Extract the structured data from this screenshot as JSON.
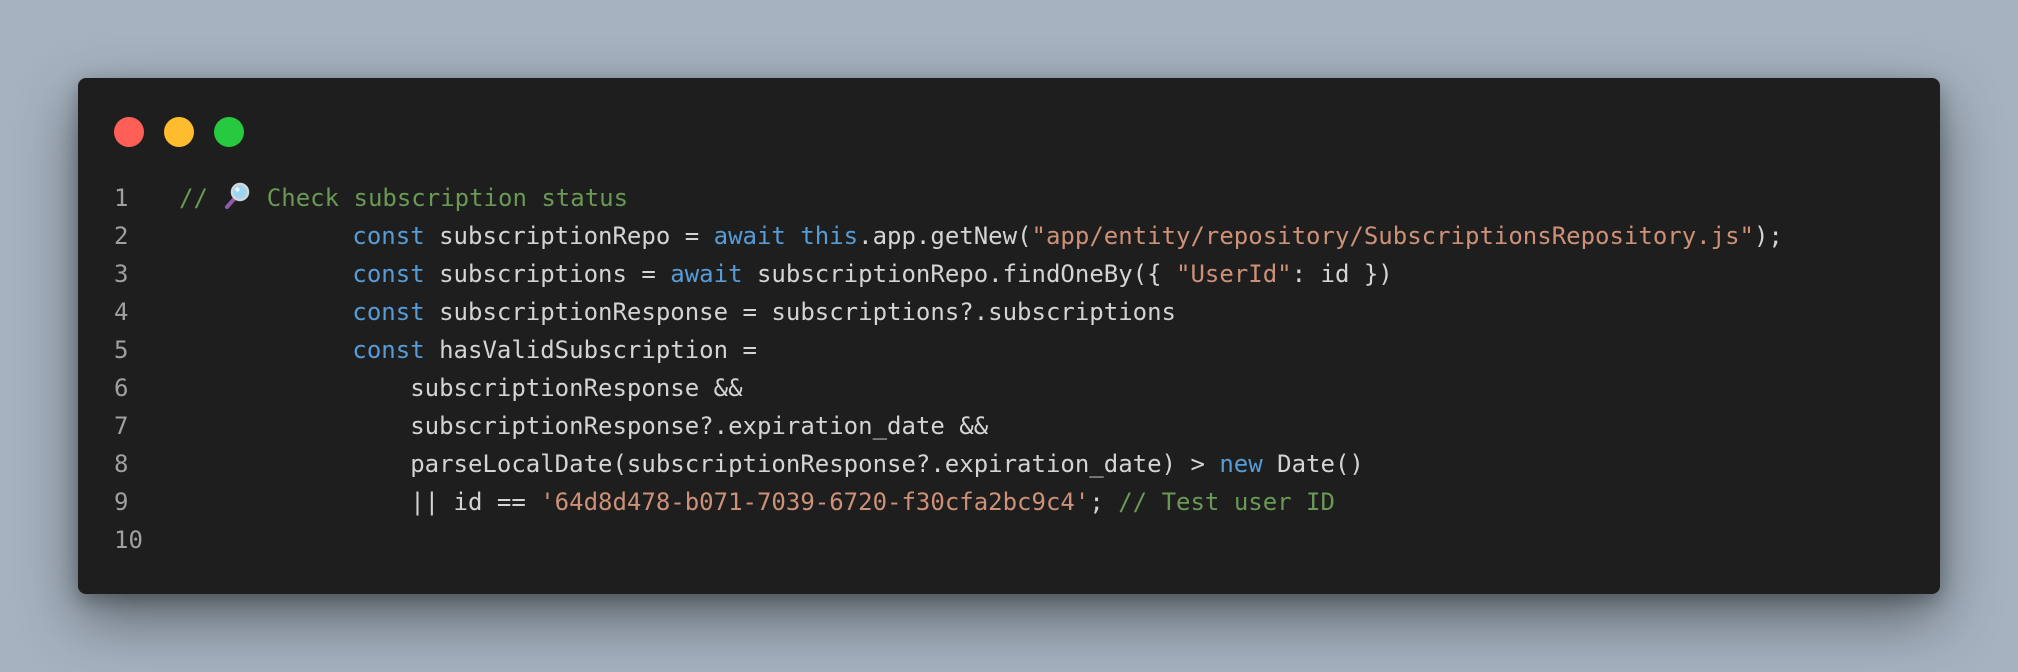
{
  "window": {
    "traffic_lights": [
      {
        "name": "close",
        "color": "#ff5f56"
      },
      {
        "name": "minimize",
        "color": "#ffbd2e"
      },
      {
        "name": "maximize",
        "color": "#27c93f"
      }
    ]
  },
  "editor": {
    "colors": {
      "background": "#1e1e1e",
      "keyword": "#569cd6",
      "string": "#ce9178",
      "comment": "#6a9955",
      "text": "#d4d4d4",
      "line_number": "#a0a0a0"
    },
    "lines": [
      {
        "num": "1",
        "tokens": [
          {
            "t": "// ",
            "c": "cm"
          },
          {
            "icon": "magnifying-glass-icon"
          },
          {
            "t": " Check subscription status",
            "c": "cm"
          }
        ]
      },
      {
        "num": "2",
        "tokens": [
          {
            "t": "            "
          },
          {
            "t": "const",
            "c": "kw"
          },
          {
            "t": " subscriptionRepo = "
          },
          {
            "t": "await",
            "c": "kw"
          },
          {
            "t": " "
          },
          {
            "t": "this",
            "c": "kw"
          },
          {
            "t": ".app.getNew("
          },
          {
            "t": "\"app/entity/repository/SubscriptionsRepository.js\"",
            "c": "str"
          },
          {
            "t": ");"
          }
        ]
      },
      {
        "num": "3",
        "tokens": [
          {
            "t": "            "
          },
          {
            "t": "const",
            "c": "kw"
          },
          {
            "t": " subscriptions = "
          },
          {
            "t": "await",
            "c": "kw"
          },
          {
            "t": " subscriptionRepo.findOneBy({ "
          },
          {
            "t": "\"UserId\"",
            "c": "str"
          },
          {
            "t": ": id })"
          }
        ]
      },
      {
        "num": "4",
        "tokens": [
          {
            "t": "            "
          },
          {
            "t": "const",
            "c": "kw"
          },
          {
            "t": " subscriptionResponse = subscriptions?.subscriptions"
          }
        ]
      },
      {
        "num": "5",
        "tokens": [
          {
            "t": "            "
          },
          {
            "t": "const",
            "c": "kw"
          },
          {
            "t": " hasValidSubscription ="
          }
        ]
      },
      {
        "num": "6",
        "tokens": [
          {
            "t": "                subscriptionResponse &&"
          }
        ]
      },
      {
        "num": "7",
        "tokens": [
          {
            "t": "                subscriptionResponse?.expiration_date &&"
          }
        ]
      },
      {
        "num": "8",
        "tokens": [
          {
            "t": "                parseLocalDate(subscriptionResponse?.expiration_date) > "
          },
          {
            "t": "new",
            "c": "kw"
          },
          {
            "t": " Date()"
          }
        ]
      },
      {
        "num": "9",
        "tokens": [
          {
            "t": "                || id == "
          },
          {
            "t": "'64d8d478-b071-7039-6720-f30cfa2bc9c4'",
            "c": "str"
          },
          {
            "t": "; "
          },
          {
            "t": "// Test user ID",
            "c": "cm"
          }
        ]
      },
      {
        "num": "10",
        "tokens": []
      }
    ]
  }
}
